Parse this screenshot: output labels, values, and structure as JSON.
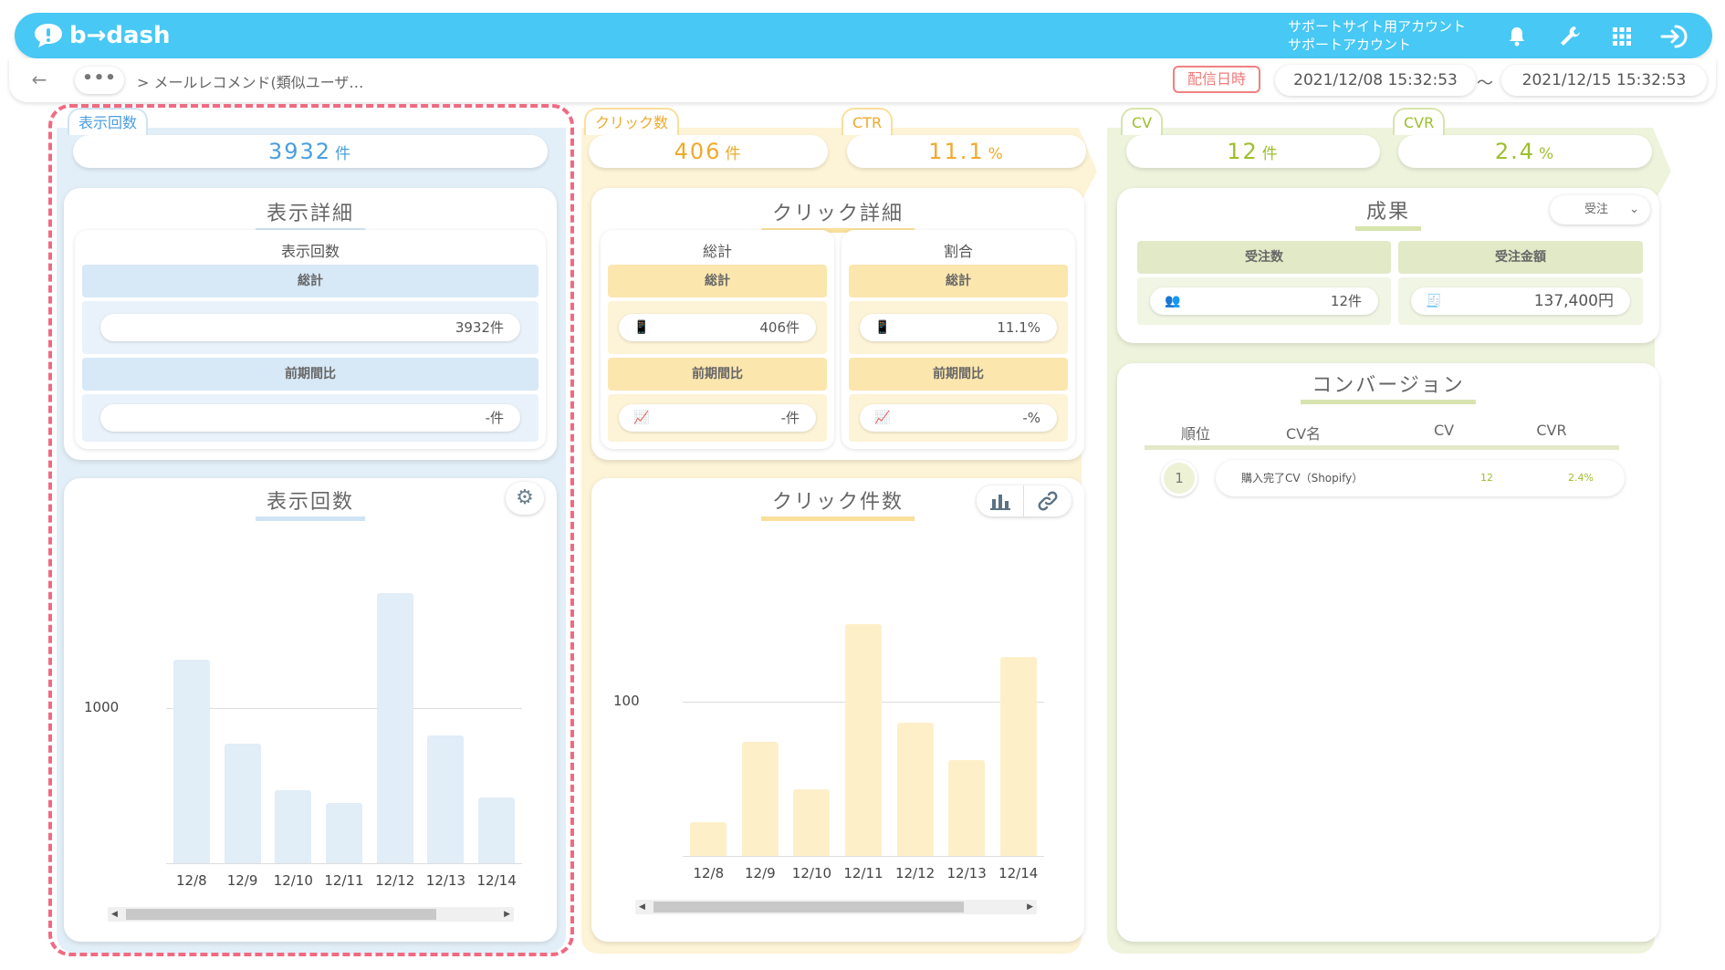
{
  "header": {
    "logo_text": "b→dash",
    "account_line1": "サポートサイト用アカウント",
    "account_line2": "サポートアカウント"
  },
  "subbar": {
    "back": "←",
    "more": "•••",
    "breadcrumb": "> メールレコメンド(類似ユーザ…",
    "delivery_label": "配信日時",
    "date_from": "2021/12/08 15:32:53",
    "tilde": "〜",
    "date_to": "2021/12/15 15:32:53"
  },
  "kpis": {
    "impressions": {
      "tab": "表示回数",
      "value": "3932",
      "unit": "件"
    },
    "clicks": {
      "tab": "クリック数",
      "value": "406",
      "unit": "件"
    },
    "ctr": {
      "tab": "CTR",
      "value": "11.1",
      "unit": "%"
    },
    "cv": {
      "tab": "CV",
      "value": "12",
      "unit": "件"
    },
    "cvr": {
      "tab": "CVR",
      "value": "2.4",
      "unit": "%"
    }
  },
  "impression_detail": {
    "title": "表示詳細",
    "section": "表示回数",
    "total_label": "総計",
    "total_value": "3932件",
    "prev_label": "前期間比",
    "prev_value": "-件"
  },
  "click_detail": {
    "title": "クリック詳細",
    "left_section": "総計",
    "right_section": "割合",
    "total_label": "総計",
    "prev_label": "前期間比",
    "left_total": "406件",
    "left_prev": "-件",
    "right_total": "11.1%",
    "right_prev": "-%"
  },
  "results": {
    "title": "成果",
    "dropdown": "受注",
    "orders_label": "受注数",
    "amount_label": "受注金額",
    "orders_value": "12件",
    "amount_value": "137,400円"
  },
  "conversion": {
    "title": "コンバージョン",
    "headers": [
      "順位",
      "CV名",
      "CV",
      "CVR"
    ],
    "rows": [
      {
        "rank": "1",
        "name": "購入完了CV（Shopify）",
        "cv": "12",
        "cvr": "2.4%"
      }
    ]
  },
  "colors": {
    "blue": "#47c8f5",
    "yellow": "#f6b73c",
    "green": "#9cbf2b",
    "red": "#f06a82"
  },
  "chart_data": [
    {
      "type": "bar",
      "title": "表示回数",
      "categories": [
        "12/8",
        "12/9",
        "12/10",
        "12/11",
        "12/12",
        "12/13",
        "12/14"
      ],
      "values": [
        1310,
        770,
        470,
        385,
        1740,
        820,
        425
      ],
      "yticks": [
        1000
      ],
      "ylim": [
        0,
        1750
      ],
      "grid": true
    },
    {
      "type": "bar",
      "title": "クリック件数",
      "categories": [
        "12/8",
        "12/9",
        "12/10",
        "12/11",
        "12/12",
        "12/13",
        "12/14"
      ],
      "values": [
        22,
        74,
        43,
        150,
        86,
        62,
        129
      ],
      "yticks": [
        100
      ],
      "ylim": [
        0,
        150
      ],
      "grid": true
    }
  ]
}
